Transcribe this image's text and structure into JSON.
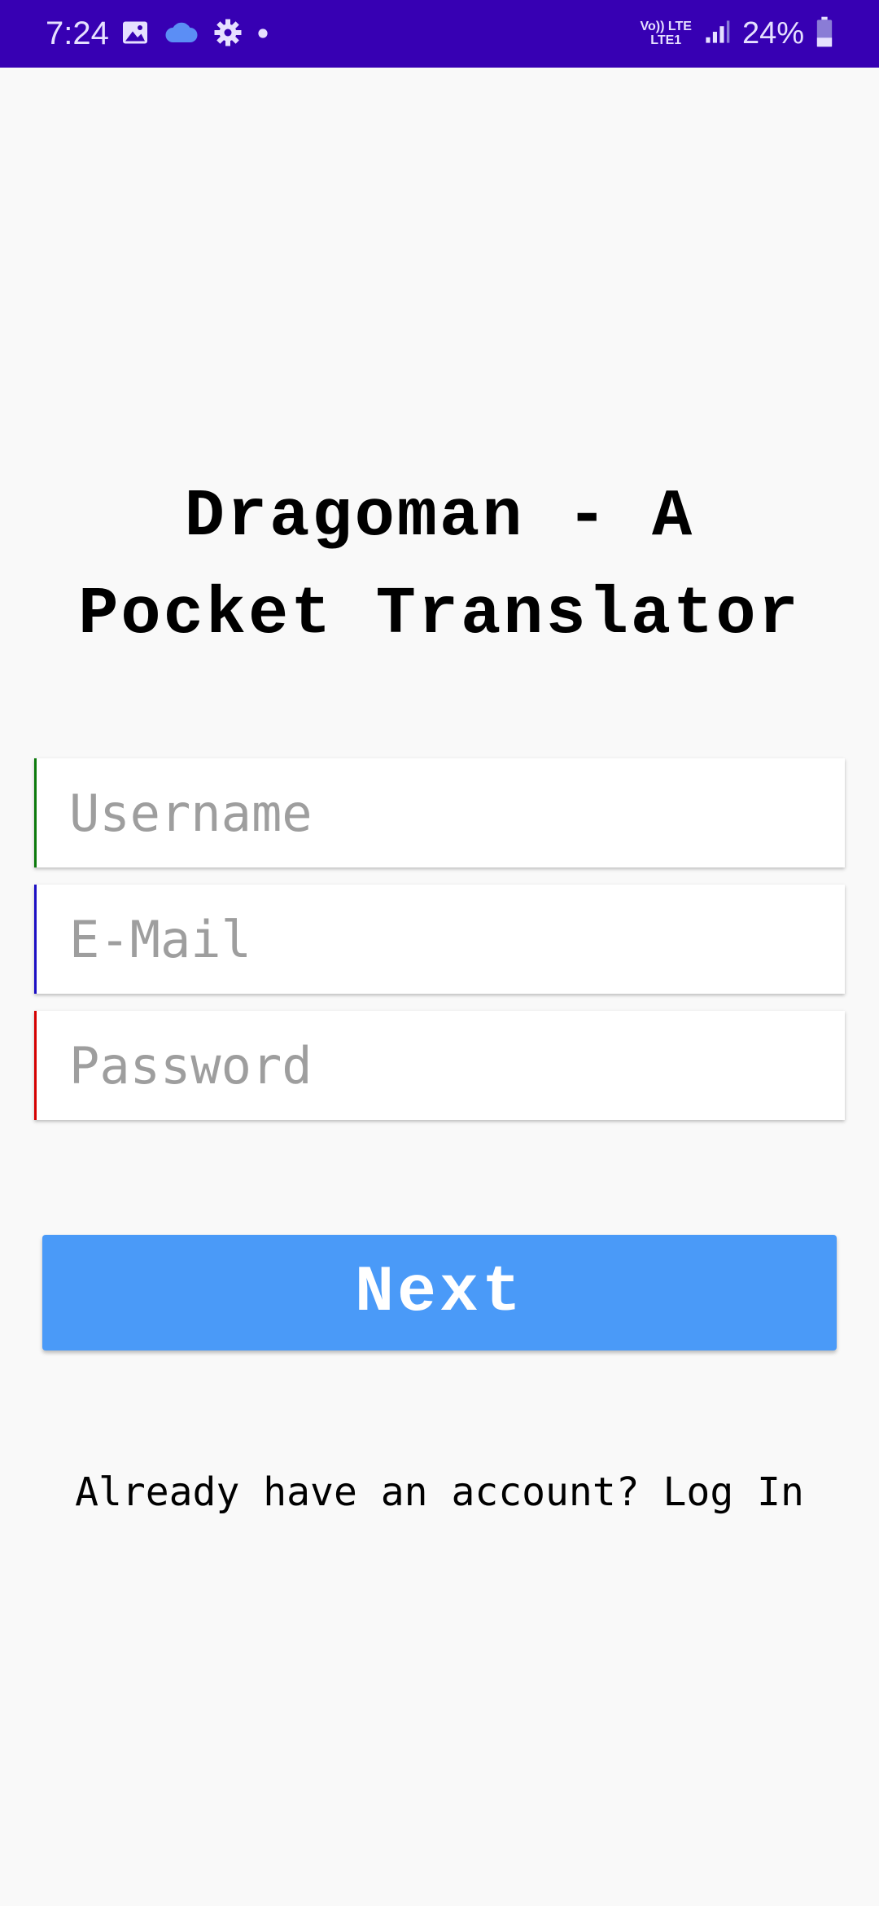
{
  "status_bar": {
    "time": "7:24",
    "battery": "24%",
    "network_top": "Vo)) LTE",
    "network_bottom": "LTE1",
    "icons": [
      "image-icon",
      "cloud-icon",
      "gear-icon",
      "dot-icon",
      "signal-icon",
      "battery-icon"
    ]
  },
  "app": {
    "title_line1": "Dragoman - A",
    "title_line2": "Pocket Translator"
  },
  "form": {
    "username_placeholder": "Username",
    "username_value": "",
    "email_placeholder": "E-Mail",
    "email_value": "",
    "password_placeholder": "Password",
    "password_value": "",
    "accent_colors": {
      "username": "#0c7a0c",
      "email": "#1c0fc4",
      "password": "#d50000"
    }
  },
  "next_button": {
    "label": "Next",
    "color": "#4a9af8"
  },
  "footer": {
    "prompt": "Already have an account?",
    "login_link": "Log In"
  },
  "colors": {
    "status_bar": "#3700b3",
    "background": "#f9f9f9"
  }
}
